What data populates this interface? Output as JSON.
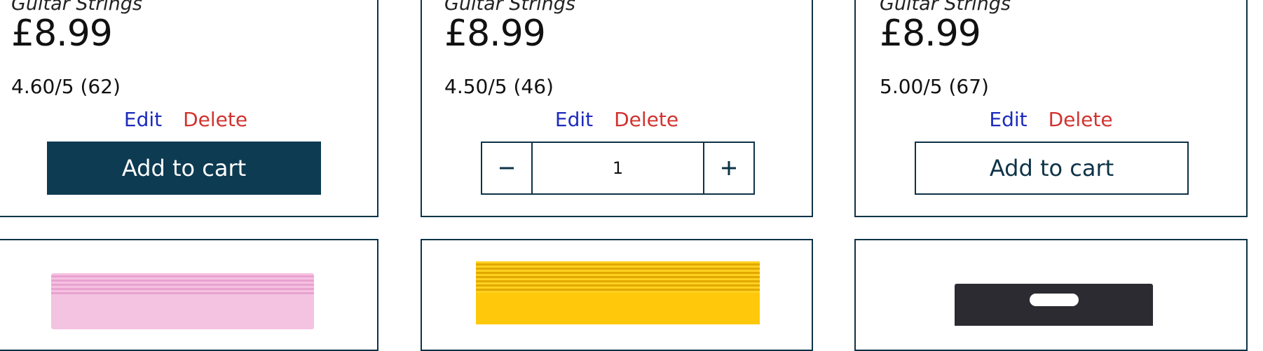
{
  "products": [
    {
      "category": "Guitar Strings",
      "price": "£8.99",
      "rating": "4.60/5 (62)",
      "edit_label": "Edit",
      "delete_label": "Delete",
      "cart_label": "Add to cart",
      "cart_state": "filled"
    },
    {
      "category": "Guitar Strings",
      "price": "£8.99",
      "rating": "4.50/5 (46)",
      "edit_label": "Edit",
      "delete_label": "Delete",
      "quantity": "1",
      "cart_state": "in-cart"
    },
    {
      "category": "Guitar Strings",
      "price": "£8.99",
      "rating": "5.00/5 (67)",
      "edit_label": "Edit",
      "delete_label": "Delete",
      "cart_label": "Add to cart",
      "cart_state": "outline"
    }
  ],
  "icons": {
    "decrement": "minus-icon",
    "increment": "plus-icon"
  },
  "colors": {
    "border": "#0d3347",
    "primary_button": "#0d3b52",
    "edit_link": "#1c2bbd",
    "delete_link": "#d2332f",
    "package_pink": "#f4c3e2",
    "package_yellow": "#ffc80a",
    "package_black": "#2b2b31"
  }
}
